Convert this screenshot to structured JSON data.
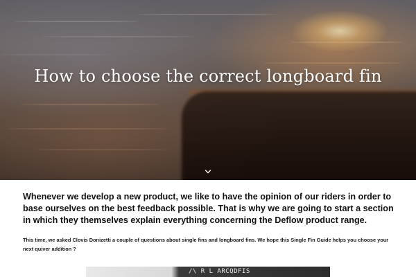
{
  "hero": {
    "title": "How to choose the correct longboard fin",
    "scroll_icon": "chevron-down-icon"
  },
  "article": {
    "intro": "Whenever we develop a new product, we like to have the opinion of our riders in order to base ourselves on the best feedback possible. That is why we are going to start a section in which they themselves explain everything concerning the Deflow product range.",
    "body": "This time, we asked Clovis Donizetti a couple of questions about single fins and longboard fins. We hope this Single Fin Guide helps you choose your next quiver addition ?",
    "image_text": "/\\ R L ARCQDFIS"
  },
  "colors": {
    "hero_title": "#ffffff",
    "text": "#111111",
    "background": "#ffffff"
  }
}
